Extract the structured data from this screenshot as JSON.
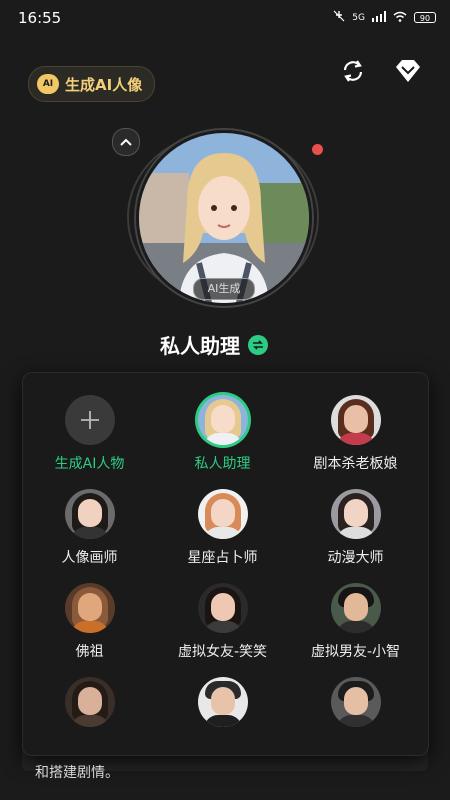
{
  "status": {
    "time": "16:55",
    "battery": "90",
    "net": "5G"
  },
  "header": {
    "generate_label": "生成AI人像",
    "ai_badge": "AI"
  },
  "assistant": {
    "ai_tag": "AI生成",
    "title": "私人助理"
  },
  "picker": {
    "items": [
      {
        "label": "生成AI人物",
        "kind": "add"
      },
      {
        "label": "私人助理",
        "kind": "selected"
      },
      {
        "label": "剧本杀老板娘"
      },
      {
        "label": "人像画师"
      },
      {
        "label": "星座占卜师"
      },
      {
        "label": "动漫大师"
      },
      {
        "label": "佛祖"
      },
      {
        "label": "虚拟女友-笑笑"
      },
      {
        "label": "虚拟男友-小智"
      },
      {
        "label": ""
      },
      {
        "label": ""
      },
      {
        "label": ""
      }
    ]
  },
  "background": {
    "partial_text_bottom": "和搭建剧情。"
  },
  "colors": {
    "accent": "#2dcc84",
    "gold": "#f2cf7a",
    "alert": "#e8504a"
  }
}
